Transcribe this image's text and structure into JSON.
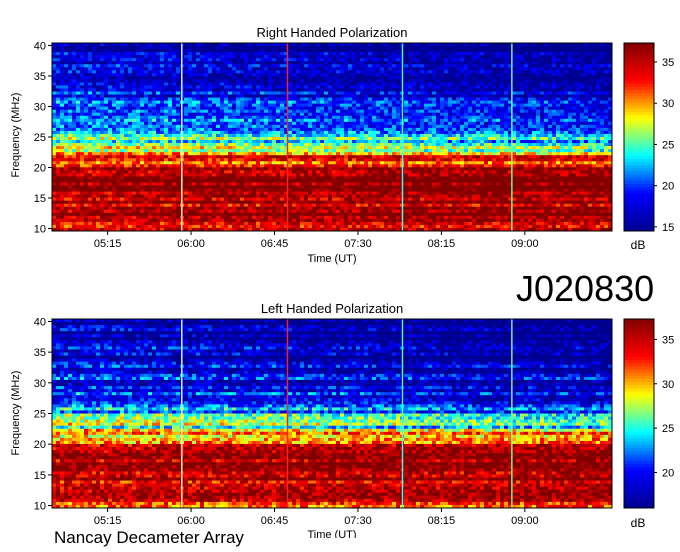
{
  "dataset_id": "J020830",
  "observatory": "Nancay Decameter Array",
  "chart_data": [
    {
      "type": "heatmap",
      "title": "Right Handed Polarization",
      "xlabel": "Time (UT)",
      "ylabel": "Frequency (MHz)",
      "xticks": [
        "05:15",
        "06:00",
        "06:45",
        "07:30",
        "08:15",
        "09:00"
      ],
      "xlim": [
        "04:45",
        "09:47"
      ],
      "yticks": [
        10,
        15,
        20,
        25,
        30,
        35,
        40
      ],
      "ylim": [
        9.6,
        40.4
      ],
      "colorbar": {
        "label": "dB",
        "ticks": [
          15,
          20,
          25,
          30,
          35
        ],
        "range": [
          14.5,
          37.3
        ]
      },
      "colormap": [
        "#00008f",
        "#0000ff",
        "#00ffff",
        "#ffff00",
        "#ff0000",
        "#800000"
      ],
      "grid": false,
      "vertical_lines": [
        {
          "time": "05:55",
          "color": "#e8ffd2"
        },
        {
          "time": "06:52",
          "color": "#ff2020"
        },
        {
          "time": "07:54",
          "color": "#40ffff"
        },
        {
          "time": "08:53",
          "color": "#80ffa0"
        }
      ],
      "intensity_profile": [
        [
          10,
          32
        ],
        [
          11,
          34
        ],
        [
          12,
          36
        ],
        [
          13,
          36
        ],
        [
          14,
          35
        ],
        [
          15,
          36
        ],
        [
          16,
          37
        ],
        [
          17,
          37
        ],
        [
          18,
          37
        ],
        [
          19,
          36
        ],
        [
          20,
          34
        ],
        [
          21,
          32
        ],
        [
          22,
          31
        ],
        [
          23,
          28
        ],
        [
          24,
          26
        ],
        [
          25,
          25
        ],
        [
          26,
          23
        ],
        [
          27,
          22
        ],
        [
          28,
          22
        ],
        [
          29,
          21
        ],
        [
          30,
          20
        ],
        [
          31,
          20
        ],
        [
          32,
          19
        ],
        [
          33,
          18
        ],
        [
          34,
          18
        ],
        [
          35,
          17
        ],
        [
          36,
          19
        ],
        [
          37,
          17
        ],
        [
          38,
          17
        ],
        [
          39,
          17
        ],
        [
          40,
          16
        ]
      ]
    },
    {
      "type": "heatmap",
      "title": "Left Handed Polarization",
      "xlabel": "Time (UT)",
      "ylabel": "Frequency (MHz)",
      "xticks": [
        "05:15",
        "06:00",
        "06:45",
        "07:30",
        "08:15",
        "09:00"
      ],
      "xlim": [
        "04:45",
        "09:47"
      ],
      "yticks": [
        10,
        15,
        20,
        25,
        30,
        35,
        40
      ],
      "ylim": [
        9.6,
        40.4
      ],
      "colorbar": {
        "label": "dB",
        "ticks": [
          20,
          25,
          30,
          35
        ],
        "range": [
          16,
          37.3
        ]
      },
      "colormap": [
        "#00008f",
        "#0000ff",
        "#00ffff",
        "#ffff00",
        "#ff0000",
        "#800000"
      ],
      "grid": false,
      "vertical_lines": [
        {
          "time": "05:55",
          "color": "#e8ffd2"
        },
        {
          "time": "06:52",
          "color": "#ff2020"
        },
        {
          "time": "07:54",
          "color": "#40ffff"
        },
        {
          "time": "08:53",
          "color": "#80ffa0"
        }
      ],
      "intensity_profile": [
        [
          10,
          31
        ],
        [
          11,
          33
        ],
        [
          12,
          35
        ],
        [
          13,
          36
        ],
        [
          14,
          35
        ],
        [
          15,
          36
        ],
        [
          16,
          36
        ],
        [
          17,
          36
        ],
        [
          18,
          35
        ],
        [
          19,
          34
        ],
        [
          20,
          33
        ],
        [
          21,
          31
        ],
        [
          22,
          29
        ],
        [
          23,
          27
        ],
        [
          24,
          26
        ],
        [
          25,
          24
        ],
        [
          26,
          23
        ],
        [
          27,
          22
        ],
        [
          28,
          21
        ],
        [
          29,
          21
        ],
        [
          30,
          20
        ],
        [
          31,
          20
        ],
        [
          32,
          19
        ],
        [
          33,
          19
        ],
        [
          34,
          18
        ],
        [
          35,
          18
        ],
        [
          36,
          20
        ],
        [
          37,
          18
        ],
        [
          38,
          18
        ],
        [
          39,
          18
        ],
        [
          40,
          17
        ]
      ]
    }
  ]
}
